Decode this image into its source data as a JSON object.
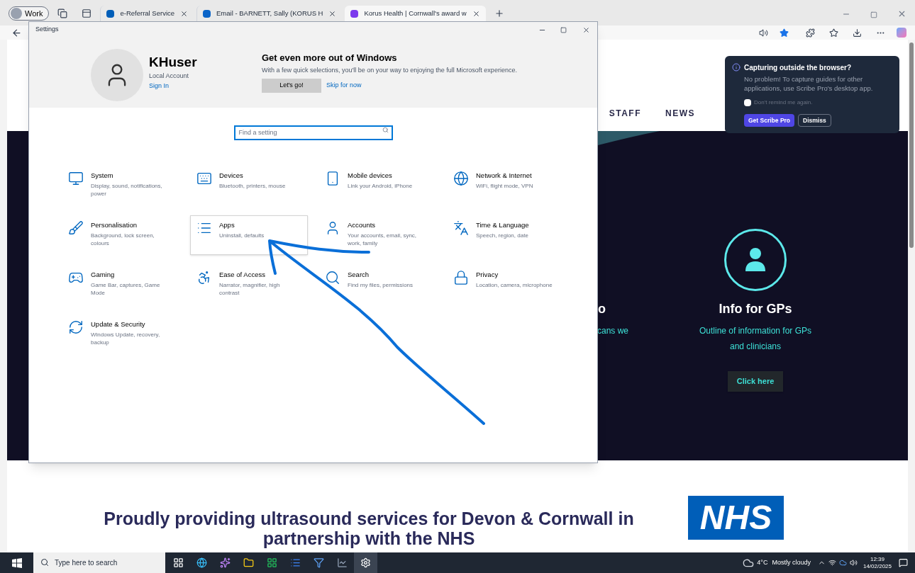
{
  "browser": {
    "profile": "Work",
    "tabs": [
      {
        "title": "e-Referral Service",
        "selected": false
      },
      {
        "title": "Email - BARNETT, Sally (KORUS H",
        "selected": false
      },
      {
        "title": "Korus Health | Cornwall's award w",
        "selected": true
      }
    ]
  },
  "website": {
    "nav": [
      "STAFF",
      "NEWS"
    ],
    "partial_column": {
      "heading": "o",
      "text": "cans we"
    },
    "info_card": {
      "title": "Info for GPs",
      "text": "Outline of information for GPs and clinicians",
      "button": "Click here"
    },
    "headline": "Proudly providing ultrasound services for Devon & Cornwall in partnership with the NHS",
    "logo": "NHS"
  },
  "scribe_popup": {
    "title": "Capturing outside the browser?",
    "text": "No problem! To capture guides for other applications, use Scribe Pro's desktop app.",
    "checkbox": {
      "label": "Don't remind me again.",
      "checked": false
    },
    "primary_button": "Get Scribe Pro",
    "secondary_button": "Dismiss"
  },
  "settings": {
    "window": {
      "title": "Settings"
    },
    "account": {
      "name": "KHuser",
      "type": "Local Account",
      "link": "Sign In"
    },
    "promo": {
      "title": "Get even more out of Windows",
      "text": "With a few quick selections, you'll be on your way to enjoying the full Microsoft experience.",
      "button": "Let's go!",
      "link": "Skip for now"
    },
    "search": {
      "placeholder": "Find a setting"
    },
    "categories": [
      {
        "kind": "system",
        "title": "System",
        "description": "Display, sound, notifications, power",
        "selected": false
      },
      {
        "kind": "devices",
        "title": "Devices",
        "description": "Bluetooth, printers, mouse",
        "selected": false
      },
      {
        "kind": "mobile",
        "title": "Mobile devices",
        "description": "Link your Android, iPhone",
        "selected": false
      },
      {
        "kind": "network",
        "title": "Network & Internet",
        "description": "WiFi, flight mode, VPN",
        "selected": false
      },
      {
        "kind": "personalisation",
        "title": "Personalisation",
        "description": "Background, lock screen, colours",
        "selected": false
      },
      {
        "kind": "apps",
        "title": "Apps",
        "description": "Uninstall, defaults",
        "selected": true
      },
      {
        "kind": "accounts",
        "title": "Accounts",
        "description": "Your accounts, email, sync, work, family",
        "selected": false
      },
      {
        "kind": "time",
        "title": "Time & Language",
        "description": "Speech, region, date",
        "selected": false
      },
      {
        "kind": "gaming",
        "title": "Gaming",
        "description": "Game Bar, captures, Game Mode",
        "selected": false
      },
      {
        "kind": "access",
        "title": "Ease of Access",
        "description": "Narrator, magnifier, high contrast",
        "selected": false
      },
      {
        "kind": "search",
        "title": "Search",
        "description": "Find my files, permissions",
        "selected": false
      },
      {
        "kind": "privacy",
        "title": "Privacy",
        "description": "Location, camera, microphone",
        "selected": false
      },
      {
        "kind": "update",
        "title": "Update & Security",
        "description": "Windows Update, recovery, backup",
        "selected": false
      }
    ]
  },
  "taskbar": {
    "search_placeholder": "Type here to search",
    "apps": [
      {
        "kind": "taskview",
        "selected": false
      },
      {
        "kind": "edge",
        "selected": false
      },
      {
        "kind": "copilot",
        "selected": false
      },
      {
        "kind": "explorer",
        "selected": false
      },
      {
        "kind": "excel",
        "selected": false
      },
      {
        "kind": "word",
        "selected": false
      },
      {
        "kind": "filter",
        "selected": false
      },
      {
        "kind": "chart",
        "selected": false
      },
      {
        "kind": "settings",
        "selected": true
      }
    ],
    "weather": {
      "temperature": "4°C",
      "condition": "Mostly cloudy"
    },
    "time": "12:39",
    "date": "14/02/2025"
  }
}
